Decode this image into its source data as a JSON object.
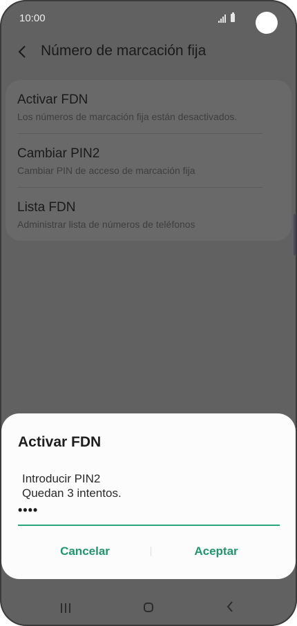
{
  "status_bar": {
    "time": "10:00"
  },
  "header": {
    "title": "Número de marcación fija"
  },
  "settings": {
    "items": [
      {
        "title": "Activar FDN",
        "subtitle": "Los números de marcación fija están desactivados."
      },
      {
        "title": "Cambiar PIN2",
        "subtitle": "Cambiar PIN de acceso de marcación fija"
      },
      {
        "title": "Lista FDN",
        "subtitle": "Administrar lista de números de teléfonos"
      }
    ]
  },
  "dialog": {
    "title": "Activar FDN",
    "message_line1": "Introducir PIN2",
    "message_line2": "Quedan 3 intentos.",
    "pin_value": "••••",
    "cancel_label": "Cancelar",
    "accept_label": "Aceptar"
  },
  "colors": {
    "accent": "#20976a",
    "dim_background": "#616161",
    "dialog_background": "#fcfcfc"
  },
  "icons": {
    "back": "chevron-left-icon",
    "recents": "recents-icon",
    "home": "home-icon",
    "nav_back": "nav-back-icon",
    "signal": "signal-icon",
    "battery": "battery-icon"
  }
}
